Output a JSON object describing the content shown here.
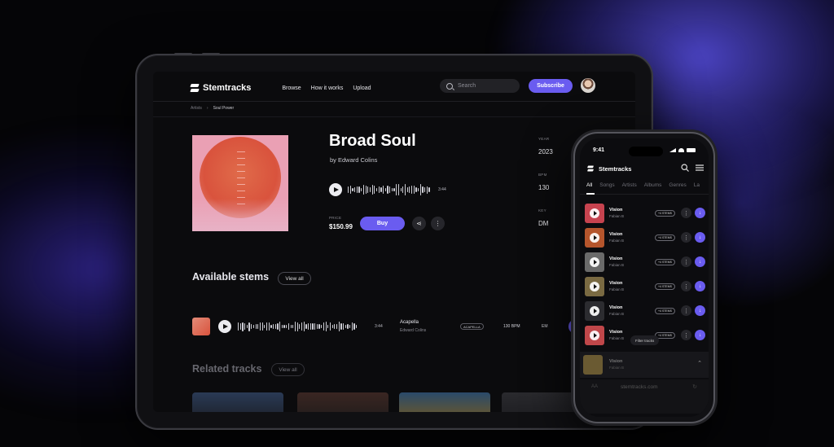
{
  "colors": {
    "accent": "#6a5cf0",
    "background": "#050507",
    "surface": "#0b0b0d"
  },
  "tablet": {
    "nav": {
      "logo": "Stemtracks",
      "links": [
        "Browse",
        "How it works",
        "Upload"
      ],
      "search_placeholder": "Search",
      "subscribe": "Subscribe"
    },
    "breadcrumb": {
      "parent": "Artists",
      "current": "Soul Power"
    },
    "track": {
      "title": "Broad Soul",
      "byline": "by Edward Colins",
      "duration": "3:44",
      "price_label": "PRICE",
      "price": "$150.99",
      "buy_label": "Buy"
    },
    "meta": [
      {
        "label": "YEAR",
        "value": "2023"
      },
      {
        "label": "BPM",
        "value": "130"
      },
      {
        "label": "KEY",
        "value": "DM"
      }
    ],
    "stems_section": {
      "heading": "Available stems",
      "view_all": "View all",
      "row": {
        "duration": "3:44",
        "name": "Acapella",
        "artist": "Edward Colins",
        "tag": "ACAPELLA",
        "bpm": "130 BPM",
        "key": "EM"
      }
    },
    "related_section": {
      "heading": "Related tracks",
      "view_all": "View all"
    }
  },
  "phone": {
    "time": "9:41",
    "logo": "Stemtracks",
    "tabs": [
      "All",
      "Songs",
      "Artists",
      "Albums",
      "Genres",
      "La"
    ],
    "tracks": [
      {
        "name": "Vision",
        "artist": "Fabian B",
        "stem": "+4 STEMS",
        "thumb": "#c7434f"
      },
      {
        "name": "Vision",
        "artist": "Fabian B",
        "stem": "+4 STEMS",
        "thumb": "#b5552c"
      },
      {
        "name": "Vision",
        "artist": "Fabian B",
        "stem": "+4 STEMS",
        "thumb": "#6a6a6a"
      },
      {
        "name": "Vision",
        "artist": "Fabian B",
        "stem": "+4 STEMS",
        "thumb": "#7a6a42"
      },
      {
        "name": "Vision",
        "artist": "Fabian B",
        "stem": "+4 STEMS",
        "thumb": "#2c2c30"
      },
      {
        "name": "Vision",
        "artist": "Fabian B",
        "stem": "+4 STEMS",
        "thumb": "#c0474a"
      }
    ],
    "filter_label": "Filter tracks",
    "now_playing": {
      "name": "Vision",
      "artist": "Fabian B"
    },
    "url": "stemtracks.com"
  }
}
